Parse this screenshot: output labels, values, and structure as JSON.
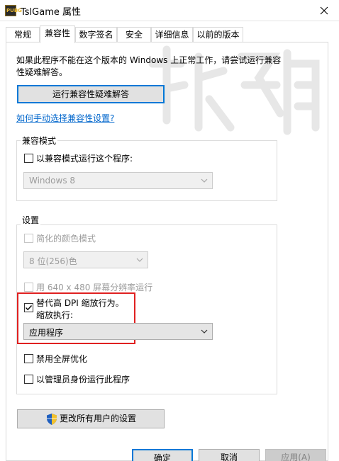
{
  "window": {
    "title": "TslGame 属性",
    "icon_text": "PUBG"
  },
  "tabs": [
    {
      "label": "常规"
    },
    {
      "label": "兼容性"
    },
    {
      "label": "数字签名"
    },
    {
      "label": "安全"
    },
    {
      "label": "详细信息"
    },
    {
      "label": "以前的版本"
    }
  ],
  "active_tab": "兼容性",
  "intro_text": "如果此程序不能在这个版本的 Windows 上正常工作，请尝试运行兼容性疑难解答。",
  "troubleshooter_button": "运行兼容性疑难解答",
  "manual_link": "如何手动选择兼容性设置?",
  "compat_mode": {
    "title": "兼容模式",
    "checkbox_label": "以兼容模式运行这个程序:",
    "checked": false,
    "os_value": "Windows 8"
  },
  "settings": {
    "title": "设置",
    "reduced_color": {
      "label": "简化的颜色模式",
      "checked": false,
      "enabled": false
    },
    "color_value": "8 位(256)色",
    "low_res": {
      "label": "用 640 x 480 屏幕分辨率运行",
      "checked": false,
      "enabled": false
    },
    "dpi_override": {
      "label": "替代高 DPI 缩放行为。",
      "checked": true
    },
    "scaling_by_label": "缩放执行:",
    "scaling_value": "应用程序",
    "fullscreen_opt": {
      "label": "禁用全屏优化",
      "checked": false
    },
    "run_as_admin": {
      "label": "以管理员身份运行此程序",
      "checked": false
    }
  },
  "all_users_button": "更改所有用户的设置",
  "buttons": {
    "ok": "确定",
    "cancel": "取消",
    "apply": "应用(A)"
  },
  "colors": {
    "accent": "#0078d7",
    "link": "#0066cc",
    "highlight": "#e02020"
  }
}
